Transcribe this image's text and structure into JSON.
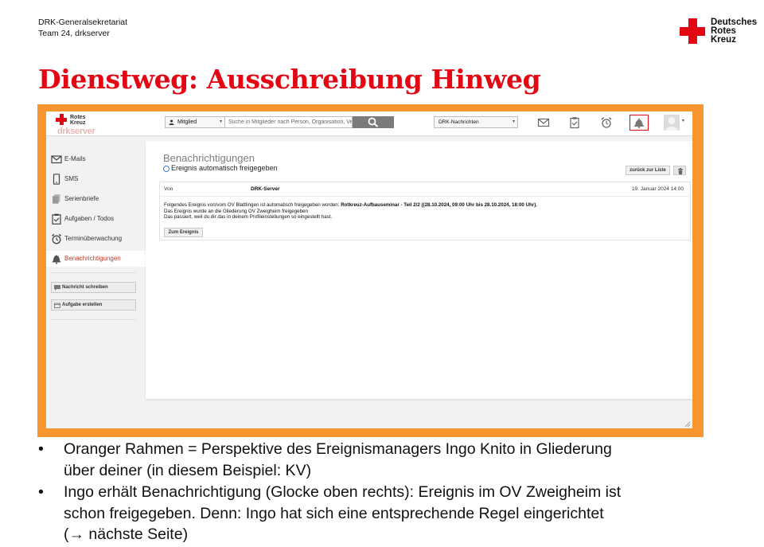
{
  "header": {
    "org_line1": "DRK-Generalsekretariat",
    "org_line2": "Team 24, drkserver",
    "logo_lines": [
      "Deutsches",
      "Rotes",
      "Kreuz"
    ],
    "title": "Dienstweg: Ausschreibung Hinweg"
  },
  "app": {
    "logo_lines": [
      "Rotes",
      "Kreuz"
    ],
    "logo_wordmark_a": "d",
    "logo_wordmark_b": "r",
    "logo_wordmark_c": "kserver",
    "member_select": "Mitglied",
    "search_placeholder": "Suche in Mitglieder nach Person, Organisation, Verband",
    "news_select": "DRK-Nachrichten",
    "icons": [
      "mail-icon",
      "clipboard-check-icon",
      "alarm-clock-icon",
      "bell-icon",
      "avatar-icon"
    ],
    "accent_color": "#e30613",
    "frame_color": "#f7962f"
  },
  "sidebar": {
    "items": [
      {
        "label": "E-Mails",
        "icon": "envelope-icon"
      },
      {
        "label": "SMS",
        "icon": "phone-icon"
      },
      {
        "label": "Serienbriefe",
        "icon": "documents-icon"
      },
      {
        "label": "Aufgaben / Todos",
        "icon": "clipboard-icon"
      },
      {
        "label": "Terminüberwachung",
        "icon": "alarm-icon"
      },
      {
        "label": "Benachrichtigungen",
        "icon": "bell-icon",
        "active": true
      }
    ],
    "buttons": [
      {
        "label": "Nachricht schreiben",
        "icon": "chat-icon"
      },
      {
        "label": "Aufgabe erstellen",
        "icon": "calendar-icon"
      }
    ]
  },
  "content": {
    "title": "Benachrichtigungen",
    "subtitle": "Ereignis automatisch freigegeben",
    "back_button": "zurück zur Liste",
    "message": {
      "from_label": "Von",
      "from_value": "DRK-Server",
      "date": "19. Januar 2024 14:00",
      "line1_prefix": "Folgendes Ereignis von/vom OV Blattlingen ist automatisch freigegeben worden: ",
      "line1_bold": "Rotkreuz-Aufbauseminar - Teil 2/2 ((28.10.2024, 09:00 Uhr bis 28.10.2024, 18:00 Uhr).",
      "line2": "Das Ereignis wurde an die Gliederung OV Zweigheim freigegeben",
      "line3": "Das passiert, weil du dir das in deinem Profileinstellungen so eingestellt hast.",
      "event_button": "Zum Ereignis"
    }
  },
  "bullets": [
    {
      "symbol": "•",
      "line1": "Oranger Rahmen = Perspektive des Ereignismanagers Ingo Knito in Gliederung",
      "line2": "über deiner (in diesem Beispiel: KV)",
      "line3": ""
    },
    {
      "symbol": "•",
      "line1": "Ingo erhält Benachrichtigung (Glocke oben rechts): Ereignis im OV Zweigheim ist",
      "line2": "schon freigegeben. Denn: Ingo hat sich eine entsprechende Regel eingerichtet",
      "line3": "(→ nächste Seite)"
    }
  ]
}
